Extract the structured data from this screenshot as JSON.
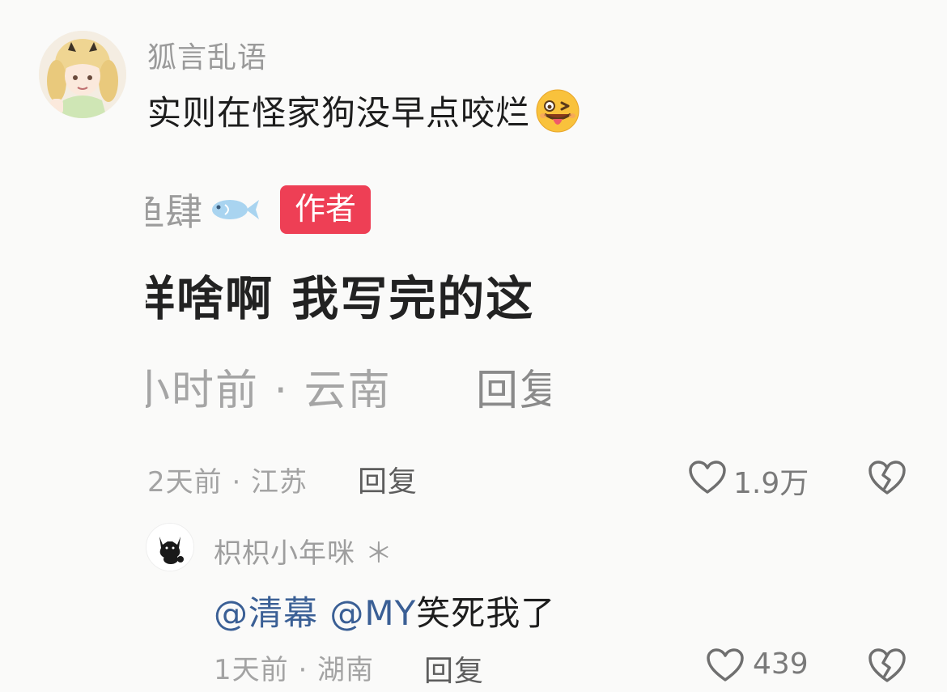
{
  "comment": {
    "username": "狐言乱语",
    "text": "实则在怪家狗没早点咬烂",
    "emoji_icon": "winking-tongue-emoji",
    "meta": "2天前 · 江苏",
    "reply_label": "回复",
    "like_count": "1.9万"
  },
  "embedded_screenshot": {
    "name_fragment": "鱼肆",
    "name_icon": "fish-icon",
    "badge": "作者",
    "text_fragment": "祥啥啊 我写完的这",
    "meta_fragment": "小时前 · 云南",
    "reply_fragment": "回复"
  },
  "reply": {
    "username": "枳枳小年咪",
    "username_suffix": "＊",
    "mention1": "@清幕",
    "mention2": "@MY",
    "text": "笑死我了",
    "meta": "1天前 · 湖南",
    "reply_label": "回复",
    "like_count": "439"
  },
  "colors": {
    "badge": "#ee3f55",
    "mention": "#3a5f95",
    "muted": "#a3a3a3"
  }
}
